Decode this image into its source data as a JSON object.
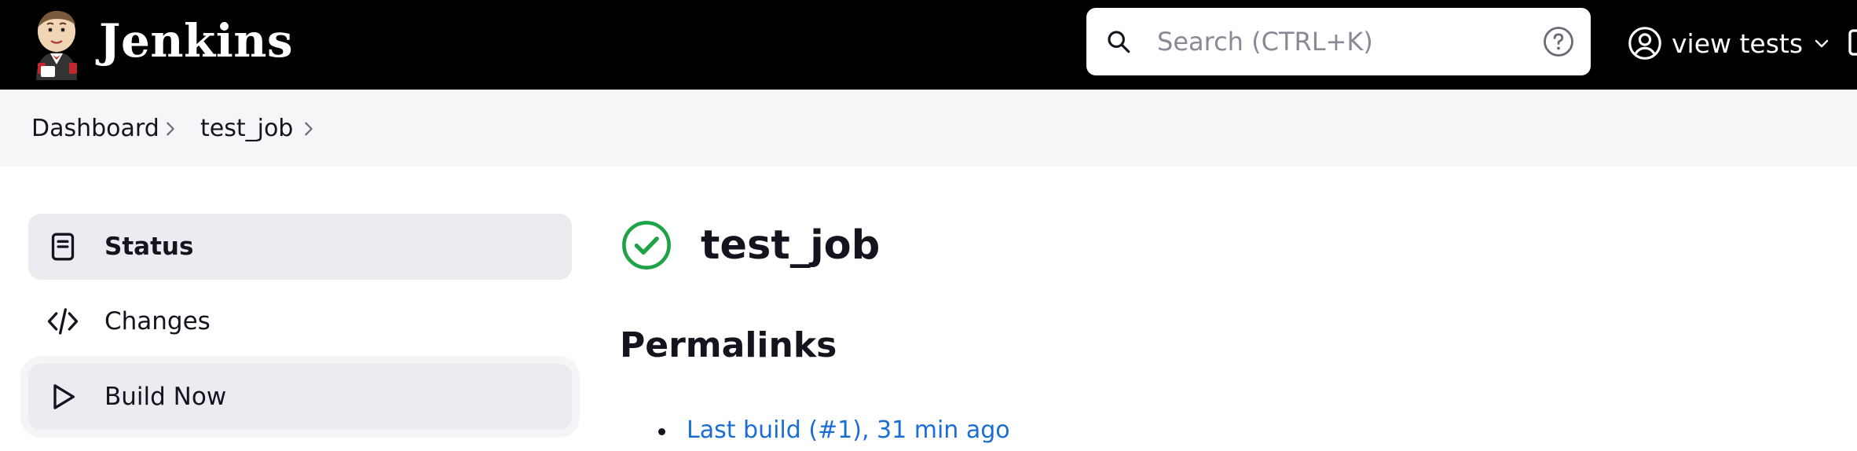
{
  "header": {
    "brand": "Jenkins",
    "search": {
      "placeholder": "Search (CTRL+K)",
      "value": ""
    },
    "user_label": "view tests"
  },
  "breadcrumb": {
    "items": [
      "Dashboard",
      "test_job"
    ]
  },
  "sidebar": {
    "items": [
      {
        "label": "Status",
        "icon": "notepad-icon"
      },
      {
        "label": "Changes",
        "icon": "code-icon"
      },
      {
        "label": "Build Now",
        "icon": "play-icon"
      }
    ]
  },
  "main": {
    "job_title": "test_job",
    "job_status": "success",
    "permalinks_title": "Permalinks",
    "permalinks": [
      {
        "label": "Last build (#1), 31 min ago"
      }
    ]
  },
  "colors": {
    "header_bg": "#000000",
    "breadcrumb_bg": "#f6f6f8",
    "active_item_bg": "#ebebf0",
    "success_green": "#1ea446",
    "link_blue": "#1a6dd2"
  }
}
